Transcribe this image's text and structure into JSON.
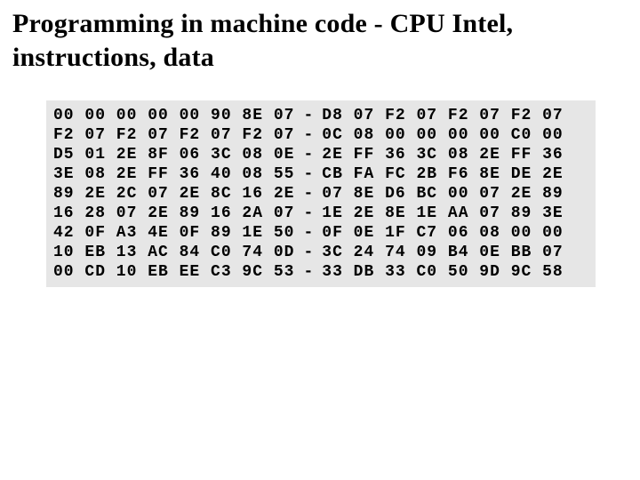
{
  "title": "Programming in machine code - CPU Intel, instructions, data",
  "hex": {
    "left_rows": [
      [
        "00",
        "00",
        "00",
        "00",
        "00",
        "90",
        "8E",
        "07"
      ],
      [
        "F2",
        "07",
        "F2",
        "07",
        "F2",
        "07",
        "F2",
        "07"
      ],
      [
        "D5",
        "01",
        "2E",
        "8F",
        "06",
        "3C",
        "08",
        "0E"
      ],
      [
        "3E",
        "08",
        "2E",
        "FF",
        "36",
        "40",
        "08",
        "55"
      ],
      [
        "89",
        "2E",
        "2C",
        "07",
        "2E",
        "8C",
        "16",
        "2E"
      ],
      [
        "16",
        "28",
        "07",
        "2E",
        "89",
        "16",
        "2A",
        "07"
      ],
      [
        "42",
        "0F",
        "A3",
        "4E",
        "0F",
        "89",
        "1E",
        "50"
      ],
      [
        "10",
        "EB",
        "13",
        "AC",
        "84",
        "C0",
        "74",
        "0D"
      ],
      [
        "00",
        "CD",
        "10",
        "EB",
        "EE",
        "C3",
        "9C",
        "53"
      ]
    ],
    "right_rows": [
      [
        "D8",
        "07",
        "F2",
        "07",
        "F2",
        "07",
        "F2",
        "07"
      ],
      [
        "0C",
        "08",
        "00",
        "00",
        "00",
        "00",
        "C0",
        "00"
      ],
      [
        "2E",
        "FF",
        "36",
        "3C",
        "08",
        "2E",
        "FF",
        "36"
      ],
      [
        "CB",
        "FA",
        "FC",
        "2B",
        "F6",
        "8E",
        "DE",
        "2E"
      ],
      [
        "07",
        "8E",
        "D6",
        "BC",
        "00",
        "07",
        "2E",
        "89"
      ],
      [
        "1E",
        "2E",
        "8E",
        "1E",
        "AA",
        "07",
        "89",
        "3E"
      ],
      [
        "0F",
        "0E",
        "1F",
        "C7",
        "06",
        "08",
        "00",
        "00"
      ],
      [
        "3C",
        "24",
        "74",
        "09",
        "B4",
        "0E",
        "BB",
        "07"
      ],
      [
        "33",
        "DB",
        "33",
        "C0",
        "50",
        "9D",
        "9C",
        "58"
      ]
    ],
    "separator": "-"
  }
}
